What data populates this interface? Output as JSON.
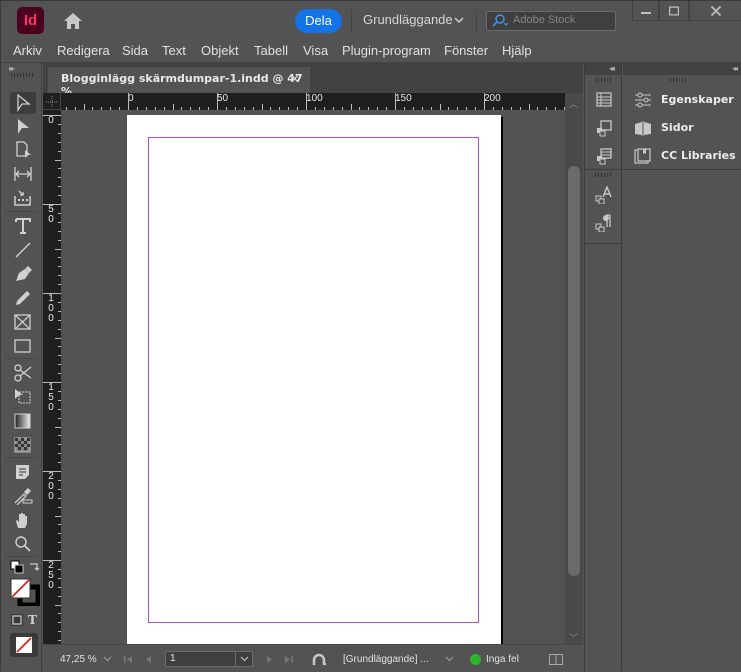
{
  "app": {
    "logo_text": "Id",
    "share_label": "Dela",
    "workspace": "Grundläggande",
    "search_placeholder": "Adobe Stock",
    "colors": {
      "accent": "#1473e6",
      "logo_bg": "#49021f",
      "logo_fg": "#ff3366",
      "margin_guide": "#b24ed0",
      "status_ok": "#2db52d"
    }
  },
  "menu": [
    "Arkiv",
    "Redigera",
    "Sida",
    "Text",
    "Objekt",
    "Tabell",
    "Visa",
    "Plugin-program",
    "Fönster",
    "Hjälp"
  ],
  "document": {
    "tab_title": "Blogginlägg skärmdumpar-1.indd @ 47 %",
    "close_glyph": "×",
    "ruler_h": [
      "0",
      "50",
      "100",
      "150",
      "200"
    ],
    "ruler_v": [
      "0",
      "50",
      "100",
      "150",
      "200",
      "250"
    ]
  },
  "tools": [
    {
      "name": "selection-tool-icon"
    },
    {
      "name": "direct-selection-tool-icon"
    },
    {
      "name": "page-tool-icon"
    },
    {
      "name": "gap-tool-icon"
    },
    {
      "name": "content-collector-icon"
    },
    {
      "name": "type-tool-icon"
    },
    {
      "name": "line-tool-icon"
    },
    {
      "name": "pen-tool-icon"
    },
    {
      "name": "pencil-tool-icon"
    },
    {
      "name": "rectangle-frame-tool-icon"
    },
    {
      "name": "rectangle-tool-icon"
    },
    {
      "name": "scissors-tool-icon"
    },
    {
      "name": "free-transform-tool-icon"
    },
    {
      "name": "gradient-swatch-tool-icon"
    },
    {
      "name": "gradient-feather-tool-icon"
    },
    {
      "name": "note-tool-icon"
    },
    {
      "name": "eyedropper-tool-icon"
    },
    {
      "name": "hand-tool-icon"
    },
    {
      "name": "zoom-tool-icon"
    }
  ],
  "status": {
    "zoom": "47,25 %",
    "page": "1",
    "master": "[Grundläggande] ...",
    "preflight": "Inga fel"
  },
  "panels": {
    "items": [
      {
        "label": "Egenskaper"
      },
      {
        "label": "Sidor"
      },
      {
        "label": "CC Libraries"
      }
    ]
  }
}
